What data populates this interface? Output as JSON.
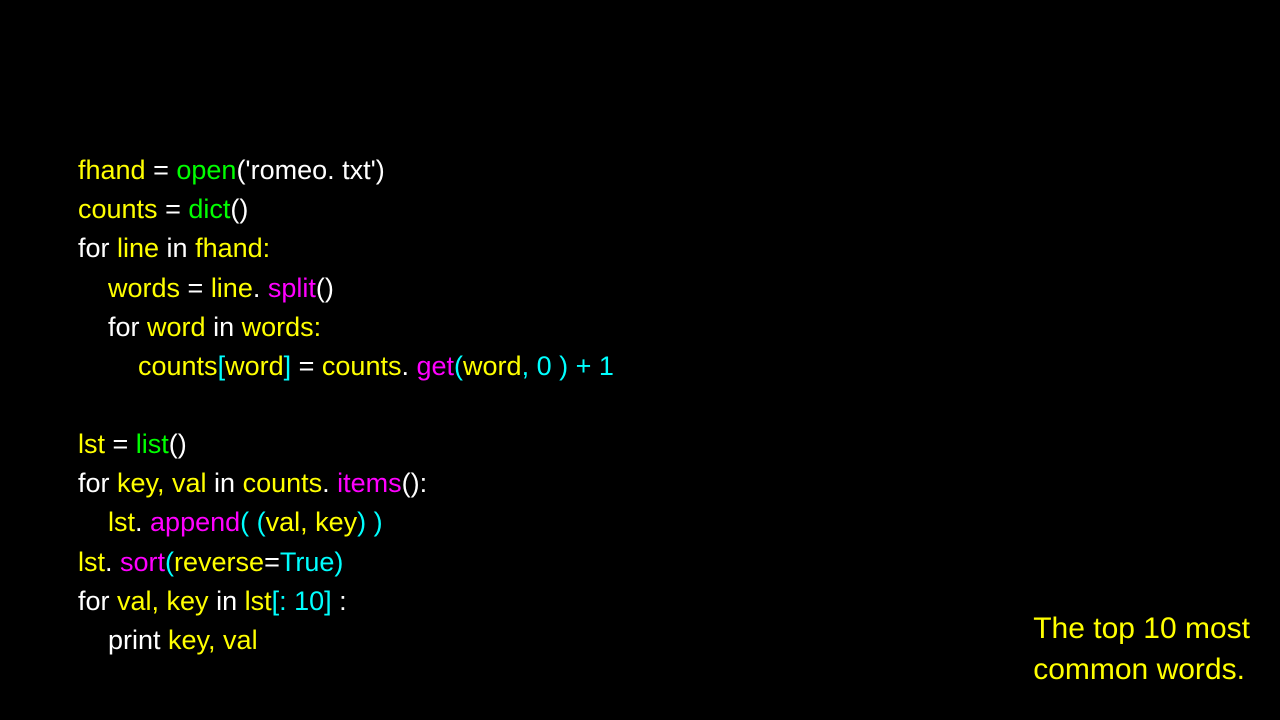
{
  "code": {
    "l1": {
      "t1": "fhand",
      "t2": " = ",
      "t3": "open",
      "t4": "('romeo. txt')"
    },
    "l2": {
      "t1": "counts",
      "t2": " = ",
      "t3": "dict",
      "t4": "()"
    },
    "l3": {
      "t1": "for ",
      "t2": "line",
      "t3": " in ",
      "t4": "fhand:"
    },
    "l4": {
      "t1": "    words",
      "t2": " = ",
      "t3": "line",
      "t4": ". ",
      "t5": "split",
      "t6": "()"
    },
    "l5": {
      "t1": "    for ",
      "t2": "word",
      "t3": " in ",
      "t4": "words:"
    },
    "l6": {
      "t1": "        counts",
      "t2": "[",
      "t3": "word",
      "t4": "]",
      "t5": " = ",
      "t6": "counts",
      "t7": ". ",
      "t8": "get",
      "t9": "(",
      "t10": "word",
      "t11": ", 0 ) + 1"
    },
    "l7": "",
    "l8": {
      "t1": "lst",
      "t2": " = ",
      "t3": "list",
      "t4": "()"
    },
    "l9": {
      "t1": "for ",
      "t2": "key, val",
      "t3": " in ",
      "t4": "counts",
      "t5": ". ",
      "t6": "items",
      "t7": "():"
    },
    "l10": {
      "t1": "    lst",
      "t2": ". ",
      "t3": "append",
      "t4": "( (",
      "t5": "val, key",
      "t6": ") )"
    },
    "l11": {
      "t1": "lst",
      "t2": ". ",
      "t3": "sort",
      "t4": "(",
      "t5": "reverse",
      "t6": "=",
      "t7": "True",
      "t8": ")"
    },
    "l12": {
      "t1": "for ",
      "t2": "val, key",
      "t3": " in ",
      "t4": "lst",
      "t5": "[: 10]",
      "t6": " :"
    },
    "l13": {
      "t1": "    print ",
      "t2": "key, val"
    }
  },
  "caption": {
    "line1": "The top 10 most",
    "line2": "common words."
  }
}
